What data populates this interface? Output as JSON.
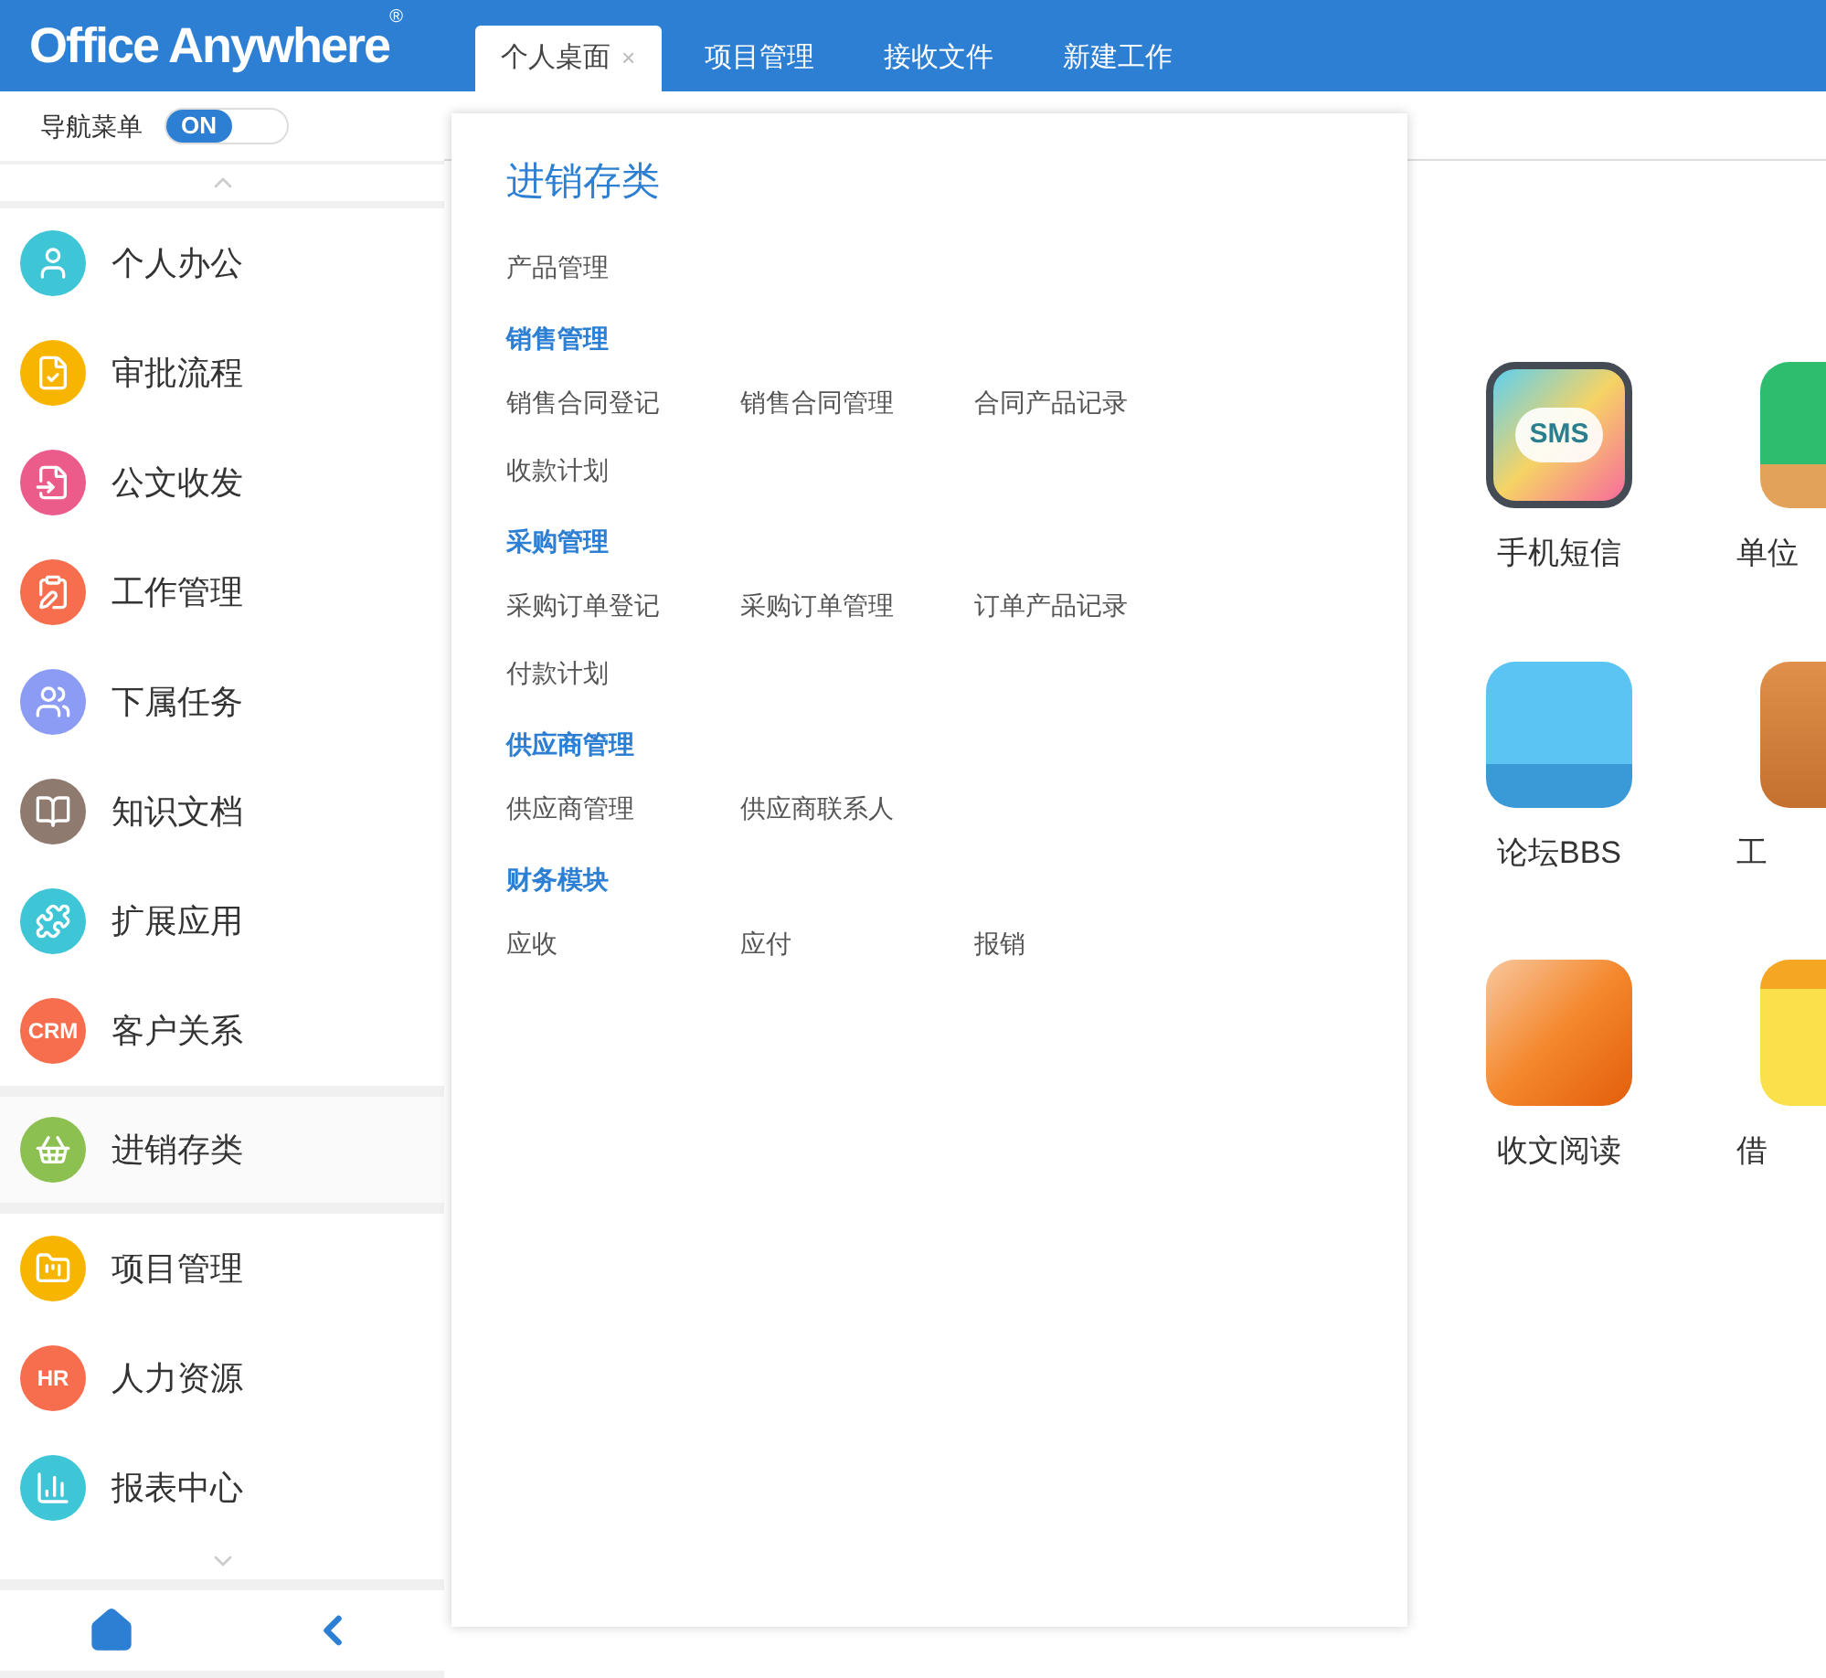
{
  "header": {
    "logo": "Office Anywhere",
    "logo_mark": "®"
  },
  "tabs": [
    {
      "label": "个人桌面",
      "selected": true,
      "close": "×"
    },
    {
      "label": "项目管理",
      "selected": false
    },
    {
      "label": "接收文件",
      "selected": false
    },
    {
      "label": "新建工作",
      "selected": false
    }
  ],
  "nav_toggle": {
    "label": "导航菜单",
    "on": true,
    "text": "ON"
  },
  "sidebar": {
    "items": [
      {
        "label": "个人办公",
        "color": "#3ec6d6",
        "selected": false
      },
      {
        "label": "审批流程",
        "color": "#f7b500",
        "selected": false
      },
      {
        "label": "公文收发",
        "color": "#ec5c8a",
        "selected": false
      },
      {
        "label": "工作管理",
        "color": "#f76e4e",
        "selected": false
      },
      {
        "label": "下属任务",
        "color": "#8c9cf5",
        "selected": false
      },
      {
        "label": "知识文档",
        "color": "#8f7a6f",
        "selected": false
      },
      {
        "label": "扩展应用",
        "color": "#3ec6d6",
        "selected": false
      },
      {
        "label": "客户关系",
        "color": "#f76e4e",
        "selected": false,
        "icon_text": "CRM"
      },
      {
        "label": "进销存类",
        "color": "#8cc152",
        "selected": true
      },
      {
        "label": "项目管理",
        "color": "#f7b500",
        "selected": false
      },
      {
        "label": "人力资源",
        "color": "#f76e4e",
        "selected": false,
        "icon_text": "HR"
      },
      {
        "label": "报表中心",
        "color": "#3ec6d6",
        "selected": false
      }
    ]
  },
  "menu_panel": {
    "title": "进销存类",
    "sections": [
      {
        "items": [
          "产品管理"
        ]
      },
      {
        "heading": "销售管理",
        "items": [
          "销售合同登记",
          "销售合同管理",
          "合同产品记录",
          "收款计划"
        ]
      },
      {
        "heading": "采购管理",
        "items": [
          "采购订单登记",
          "采购订单管理",
          "订单产品记录",
          "付款计划"
        ]
      },
      {
        "heading": "供应商管理",
        "items": [
          "供应商管理",
          "供应商联系人"
        ]
      },
      {
        "heading": "财务模块",
        "items": [
          "应收",
          "应付",
          "报销"
        ]
      }
    ]
  },
  "apps": [
    {
      "label": "手机短信",
      "icon_text": "SMS"
    },
    {
      "label": "单位"
    },
    {
      "label": "论坛BBS"
    },
    {
      "label": "工"
    },
    {
      "label": "收文阅读"
    },
    {
      "label": "借"
    }
  ]
}
